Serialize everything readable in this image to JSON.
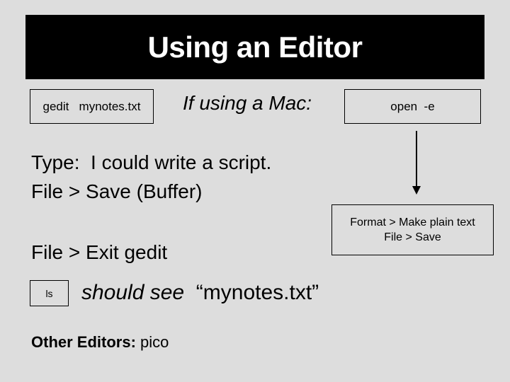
{
  "title": "Using an Editor",
  "commands": {
    "gedit": "gedit   mynotes.txt",
    "mac_label": "If using a Mac:",
    "open": "open  -e",
    "format_line1": "Format > Make plain text",
    "format_line2": "File > Save",
    "ls": "ls"
  },
  "steps": {
    "type": "Type:  I could write a script.",
    "save": "File > Save (Buffer)",
    "exit": "File > Exit gedit"
  },
  "result": {
    "emphasis": "should see",
    "filename": "“mynotes.txt”"
  },
  "other_editors": {
    "label": "Other Editors:",
    "value": "pico"
  }
}
